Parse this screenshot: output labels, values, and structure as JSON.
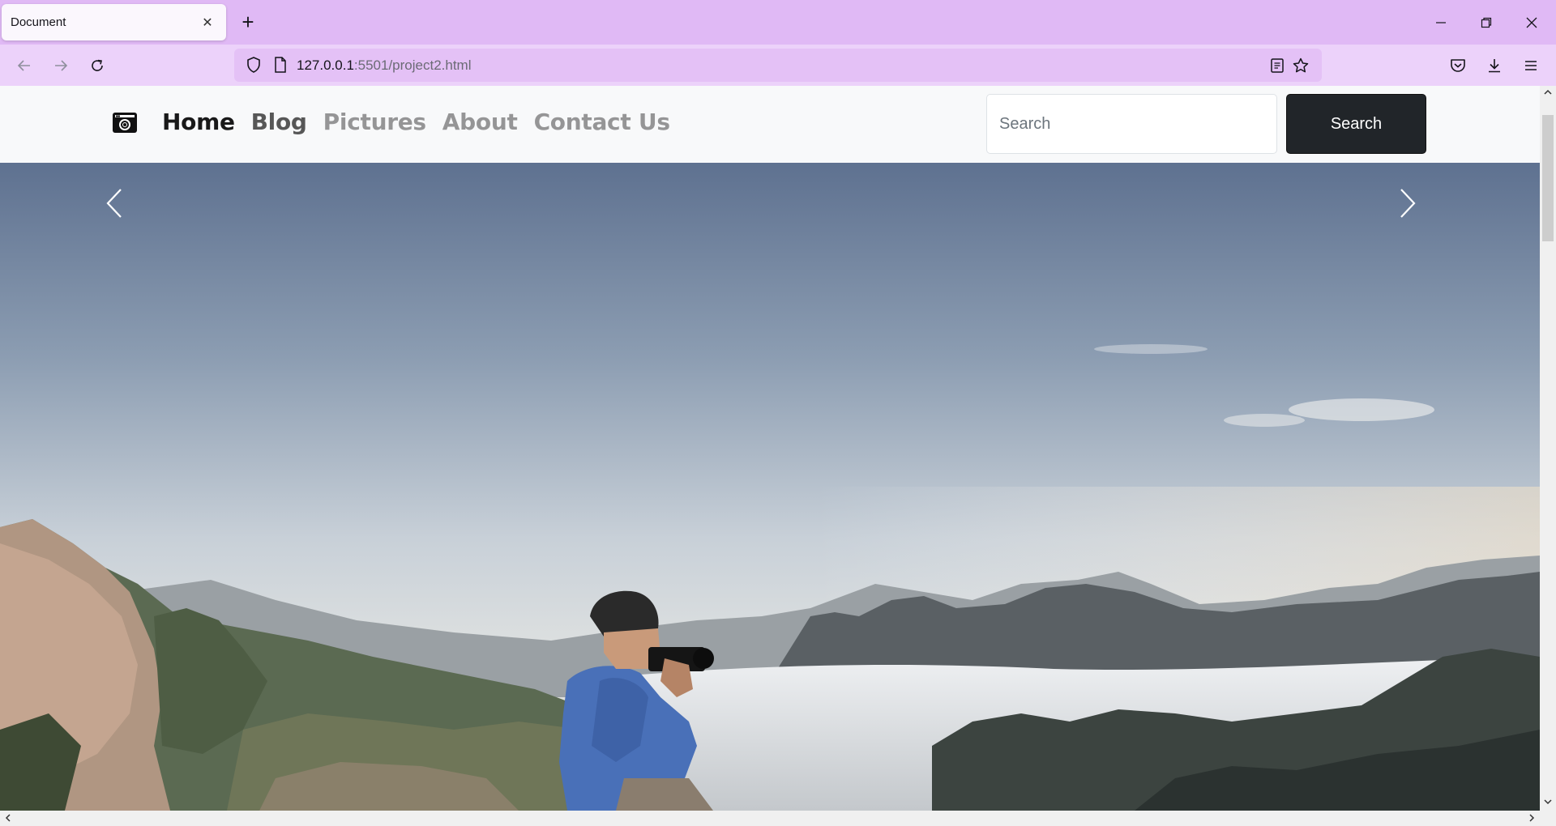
{
  "browser": {
    "tab_title": "Document",
    "tab_close": "✕",
    "new_tab": "+",
    "url_host": "127.0.0.1",
    "url_rest": ":5501/project2.html",
    "window_controls": {
      "minimize": "—",
      "restore": "❐",
      "close": "✕"
    }
  },
  "site": {
    "nav_links": [
      {
        "label": "Home"
      },
      {
        "label": "Blog"
      },
      {
        "label": "Pictures"
      },
      {
        "label": "About"
      },
      {
        "label": "Contact Us"
      }
    ],
    "search": {
      "placeholder": "Search",
      "button_label": "Search"
    }
  },
  "icons": {
    "brand": "camera-icon",
    "carousel_prev": "chevron-left-icon",
    "carousel_next": "chevron-right-icon"
  },
  "colors": {
    "tabbar": "#e0b9f5",
    "navbar": "#ecd2fa",
    "urlbar": "#e4c1f6",
    "search_button": "#212529"
  }
}
